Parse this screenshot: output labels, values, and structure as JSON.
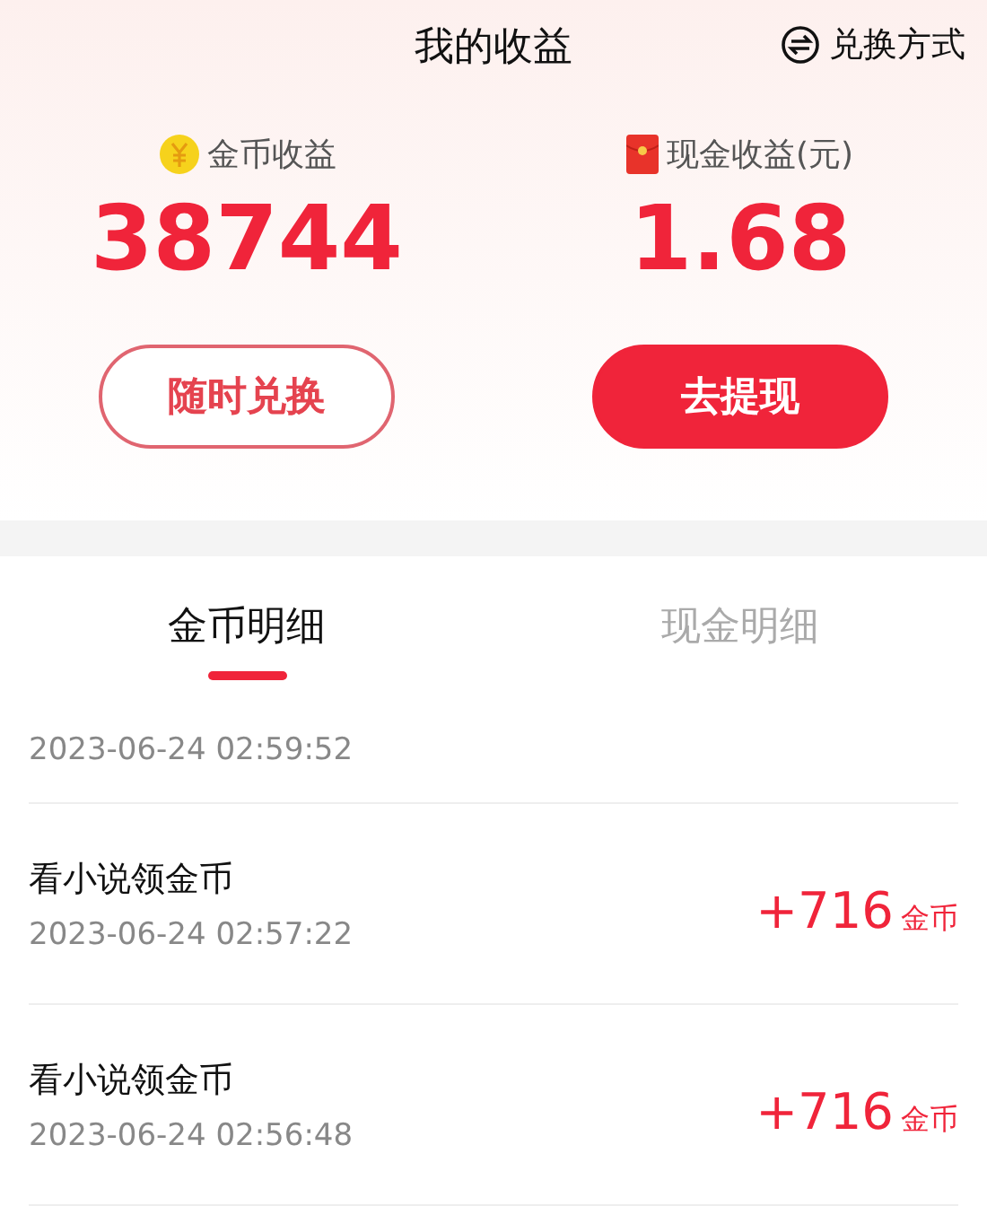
{
  "header": {
    "title": "我的收益",
    "exchange_link": "兑换方式"
  },
  "balances": [
    {
      "kind": "coin",
      "label": "金币收益",
      "value": "38744",
      "button": {
        "label": "随时兑换"
      }
    },
    {
      "kind": "cash",
      "label": "现金收益(元)",
      "value": "1.68",
      "button": {
        "label": "去提现"
      }
    }
  ],
  "tabs": [
    {
      "label": "金币明细",
      "selected": true
    },
    {
      "label": "现金明细",
      "selected": false
    }
  ],
  "records": [
    {
      "time": "2023-06-24 02:59:52"
    },
    {
      "title": "看小说领金币",
      "time": "2023-06-24 02:57:22",
      "amount": "+716",
      "unit": "金币"
    },
    {
      "title": "看小说领金币",
      "time": "2023-06-24 02:56:48",
      "amount": "+716",
      "unit": "金币"
    }
  ]
}
